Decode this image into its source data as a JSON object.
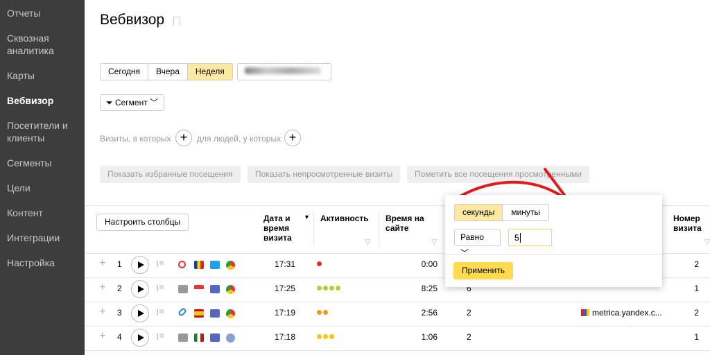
{
  "sidebar": {
    "items": [
      "Отчеты",
      "Сквозная аналитика",
      "Карты",
      "Вебвизор",
      "Посетители и клиенты",
      "Сегменты",
      "Цели",
      "Контент",
      "Интеграции",
      "Настройка"
    ],
    "active": "Вебвизор"
  },
  "page": {
    "title": "Вебвизор"
  },
  "period": {
    "today": "Сегодня",
    "yesterday": "Вчера",
    "week": "Неделя",
    "active": "Неделя"
  },
  "segment_button": "Сегмент",
  "conditions": {
    "visits": "Визиты, в которых",
    "people": "для людей, у которых"
  },
  "actions": {
    "show_favorites": "Показать избранные посещения",
    "show_unviewed": "Показать непросмотренные визиты",
    "mark_all_viewed": "Пометить все посещения просмотренными"
  },
  "table": {
    "configure_columns": "Настроить столбцы",
    "headers": {
      "datetime": "Дата и время визита",
      "activity": "Активность",
      "time_on_site": "Время на сайте",
      "visit_number": "Номер визита"
    },
    "rows": [
      {
        "n": "1",
        "time": "17:31",
        "activity_dots": 1,
        "activity_color": "#e02b2b",
        "duration": "0:00",
        "pages": "",
        "source": "",
        "visit_number": "2"
      },
      {
        "n": "2",
        "time": "17:25",
        "activity_dots": 4,
        "activity_color": "#b8cc3a",
        "duration": "8:25",
        "pages": "6",
        "source": "",
        "visit_number": "1"
      },
      {
        "n": "3",
        "time": "17:19",
        "activity_dots": 2,
        "activity_color": "#f09a1a",
        "duration": "2:56",
        "pages": "2",
        "source": "metrica.yandex.c...",
        "visit_number": "2"
      },
      {
        "n": "4",
        "time": "17:18",
        "activity_dots": 3,
        "activity_color": "#f5c518",
        "duration": "1:06",
        "pages": "2",
        "source": "",
        "visit_number": "1"
      }
    ]
  },
  "filter_popup": {
    "seconds": "секунды",
    "minutes": "минуты",
    "operator": "Равно",
    "value": "5",
    "apply": "Применить"
  }
}
